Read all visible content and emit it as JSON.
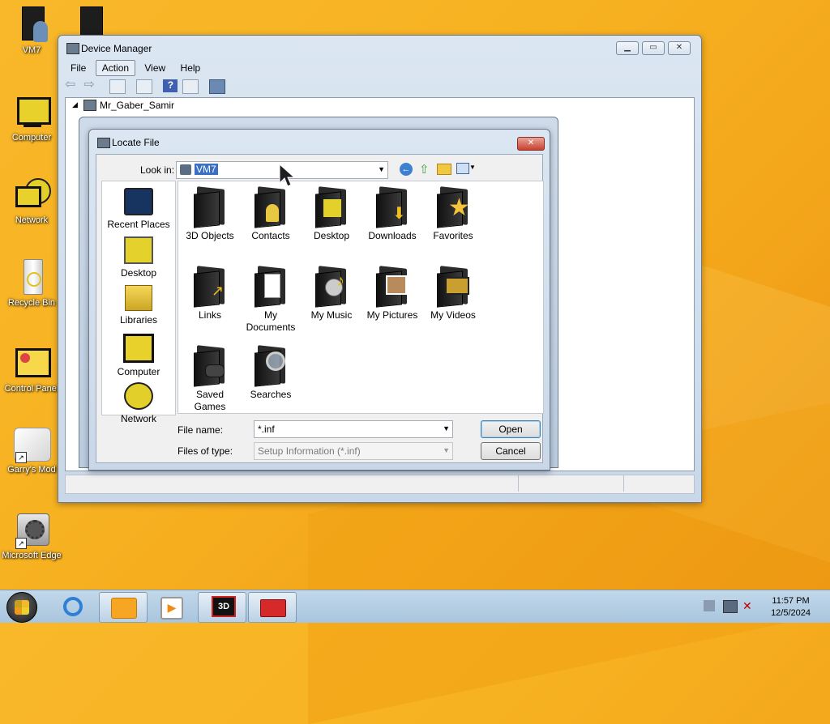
{
  "desktop": {
    "icons": [
      {
        "label": "VM7"
      },
      {
        "label": ""
      },
      {
        "label": "Computer"
      },
      {
        "label": "Network"
      },
      {
        "label": "Recycle Bin"
      },
      {
        "label": "Control Panel"
      },
      {
        "label": "Garry's Mod"
      },
      {
        "label": "Microsoft Edge"
      }
    ]
  },
  "device_manager": {
    "title": "Device Manager",
    "menu": [
      "File",
      "Action",
      "View",
      "Help"
    ],
    "tree_root": "Mr_Gaber_Samir"
  },
  "dialog": {
    "title": "Locate File",
    "look_in_label": "Look in:",
    "look_in_value": "VM7",
    "places": [
      "Recent Places",
      "Desktop",
      "Libraries",
      "Computer",
      "Network"
    ],
    "files": [
      {
        "label": "3D Objects",
        "icon": "folder-icon"
      },
      {
        "label": "Contacts",
        "icon": "contacts-folder-icon"
      },
      {
        "label": "Desktop",
        "icon": "desktop-folder-icon"
      },
      {
        "label": "Downloads",
        "icon": "downloads-folder-icon"
      },
      {
        "label": "Favorites",
        "icon": "favorites-folder-icon"
      },
      {
        "label": "Links",
        "icon": "links-folder-icon"
      },
      {
        "label": "My Documents",
        "icon": "documents-folder-icon"
      },
      {
        "label": "My Music",
        "icon": "music-folder-icon"
      },
      {
        "label": "My Pictures",
        "icon": "pictures-folder-icon"
      },
      {
        "label": "My Videos",
        "icon": "videos-folder-icon"
      },
      {
        "label": "Saved Games",
        "icon": "games-folder-icon"
      },
      {
        "label": "Searches",
        "icon": "searches-folder-icon"
      }
    ],
    "file_name_label": "File name:",
    "file_name_value": "*.inf",
    "file_type_label": "Files of type:",
    "file_type_value": "Setup Information (*.inf)",
    "open_label": "Open",
    "cancel_label": "Cancel"
  },
  "taskbar": {
    "time": "11:57 PM",
    "date": "12/5/2024",
    "apps": [
      "start-orb",
      "internet-explorer",
      "file-explorer",
      "media-player",
      "3d-app",
      "toolbox-app"
    ]
  }
}
